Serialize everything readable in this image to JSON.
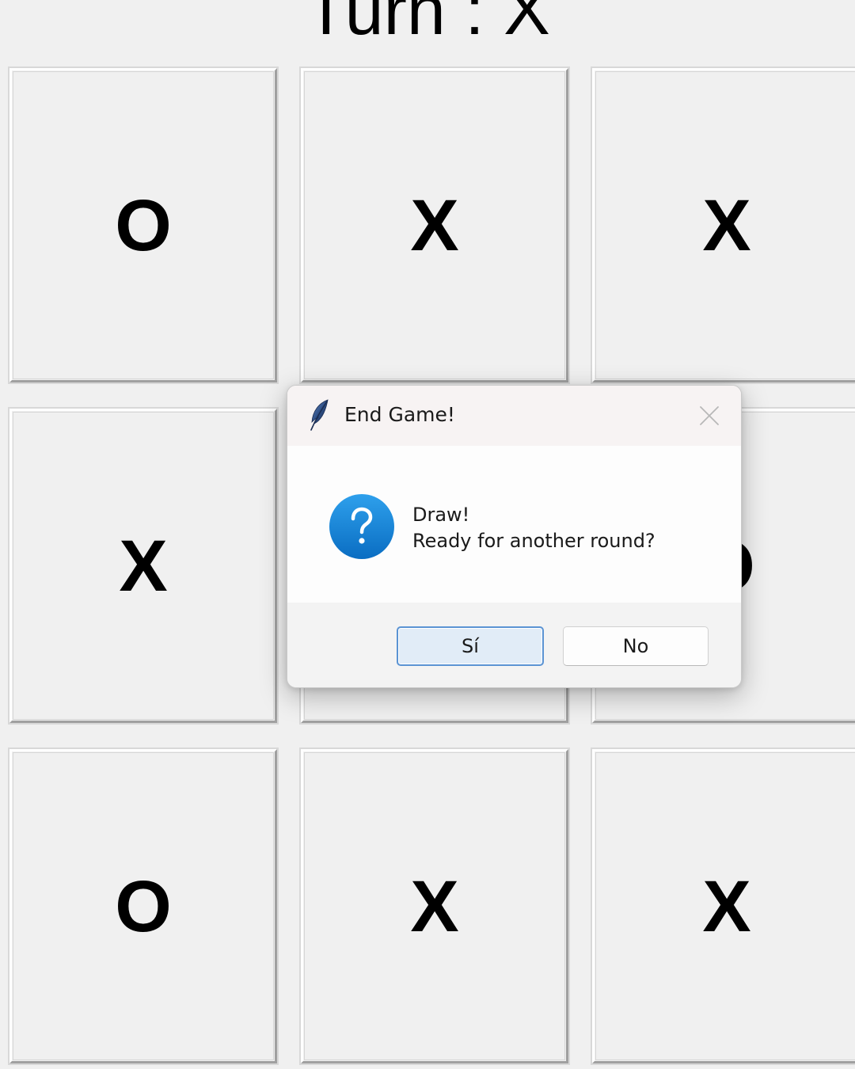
{
  "window": {
    "turn_label": "Turn : X"
  },
  "board": {
    "cells": [
      "O",
      "X",
      "X",
      "X",
      "",
      "O",
      "O",
      "X",
      "X"
    ]
  },
  "dialog": {
    "title": "End Game!",
    "app_icon": "feather-icon",
    "close_icon": "close-icon",
    "message_icon": "question-icon",
    "message_line1": "Draw!",
    "message_line2": "Ready for another round?",
    "yes_label": "Sí",
    "no_label": "No"
  },
  "colors": {
    "background": "#f0f0f0",
    "dialog_accent": "#5a93d3",
    "question_icon_blue": "#1a85d6"
  }
}
